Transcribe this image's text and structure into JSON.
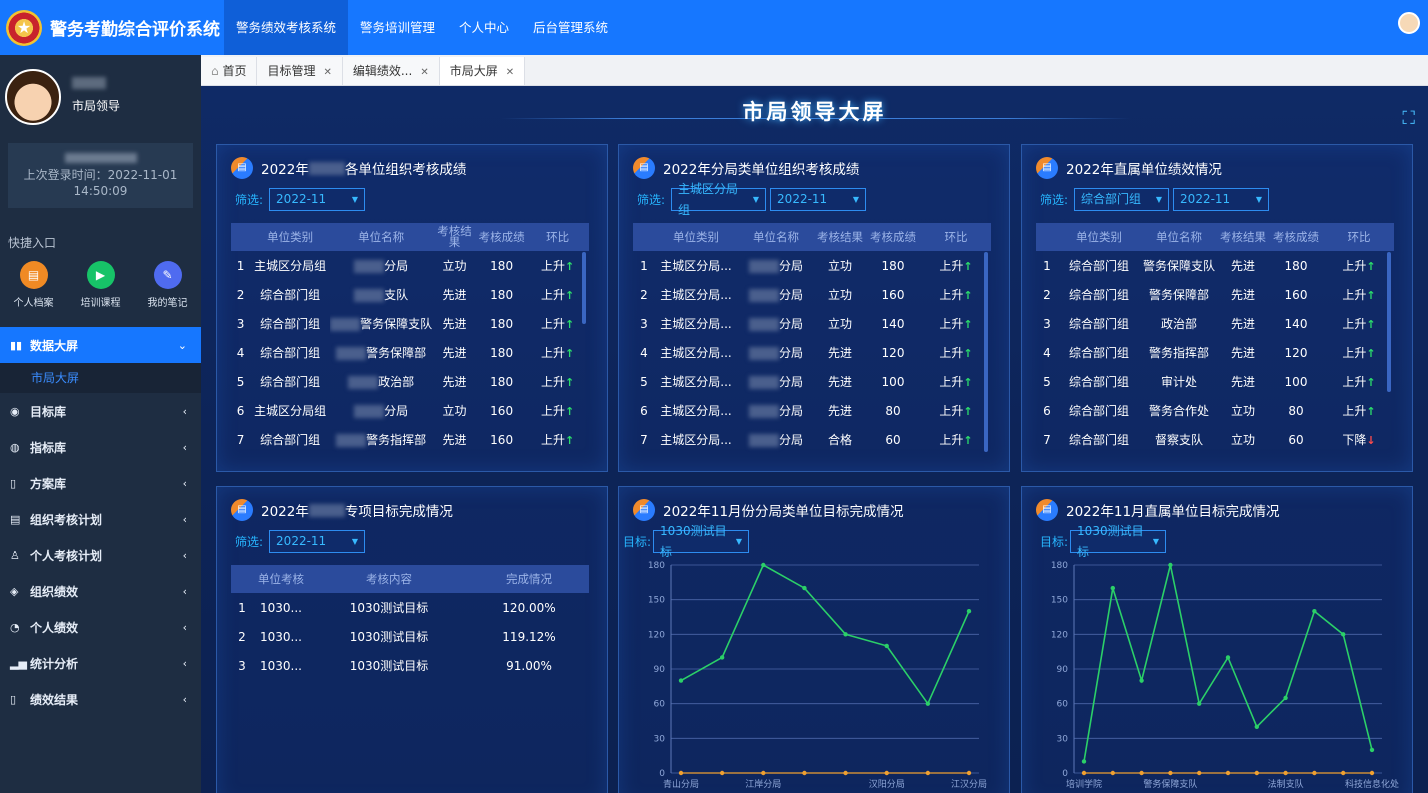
{
  "app": {
    "title": "警务考勤综合评价系统"
  },
  "topnav": [
    "警务绩效考核系统",
    "警务培训管理",
    "个人中心",
    "后台管理系统"
  ],
  "user": {
    "role": "市局领导",
    "login_label": "上次登录时间：2022-11-01",
    "login_time": "14:50:09"
  },
  "quick": {
    "title": "快捷入口",
    "items": [
      {
        "label": "个人档案",
        "color": "#f08a24",
        "icon": "file-icon"
      },
      {
        "label": "培训课程",
        "color": "#17c368",
        "icon": "play-icon"
      },
      {
        "label": "我的笔记",
        "color": "#4f6bf0",
        "icon": "edit-icon"
      }
    ]
  },
  "menu": [
    {
      "label": "数据大屏",
      "icon": "chart-icon",
      "active": true,
      "expanded": true
    },
    {
      "label": "目标库",
      "icon": "target-icon"
    },
    {
      "label": "指标库",
      "icon": "compass-icon"
    },
    {
      "label": "方案库",
      "icon": "book-icon"
    },
    {
      "label": "组织考核计划",
      "icon": "doc-icon"
    },
    {
      "label": "个人考核计划",
      "icon": "person-icon"
    },
    {
      "label": "组织绩效",
      "icon": "layers-icon"
    },
    {
      "label": "个人绩效",
      "icon": "user-icon"
    },
    {
      "label": "统计分析",
      "icon": "stats-icon"
    },
    {
      "label": "绩效结果",
      "icon": "result-icon"
    }
  ],
  "submenu": {
    "label": "市局大屏"
  },
  "tabs": [
    {
      "label": "首页",
      "closable": false
    },
    {
      "label": "目标管理",
      "closable": true
    },
    {
      "label": "编辑绩效...",
      "closable": true
    },
    {
      "label": "市局大屏",
      "closable": true,
      "active": true
    }
  ],
  "screen": {
    "title": "市局领导大屏"
  },
  "panels": {
    "p1": {
      "title_pre": "2022年",
      "title_post": "各单位组织考核成绩",
      "filter_label": "筛选:",
      "date": "2022-11",
      "headers": [
        "单位类别",
        "单位名称",
        "考核结果",
        "考核成绩",
        "环比"
      ],
      "rows": [
        [
          "1",
          "主城区分局组",
          "分局",
          "立功",
          "180",
          "上升"
        ],
        [
          "2",
          "综合部门组",
          "支队",
          "先进",
          "180",
          "上升"
        ],
        [
          "3",
          "综合部门组",
          "警务保障支队",
          "先进",
          "180",
          "上升"
        ],
        [
          "4",
          "综合部门组",
          "警务保障部",
          "先进",
          "180",
          "上升"
        ],
        [
          "5",
          "综合部门组",
          "政治部",
          "先进",
          "180",
          "上升"
        ],
        [
          "6",
          "主城区分局组",
          "分局",
          "立功",
          "160",
          "上升"
        ],
        [
          "7",
          "综合部门组",
          "警务指挥部",
          "先进",
          "160",
          "上升"
        ]
      ]
    },
    "p2": {
      "title": "2022年分局类单位组织考核成绩",
      "filter_label": "筛选:",
      "group": "主城区分局组",
      "date": "2022-11",
      "headers": [
        "单位类别",
        "单位名称",
        "考核结果",
        "考核成绩",
        "环比"
      ],
      "rows": [
        [
          "1",
          "主城区分局...",
          "分局",
          "立功",
          "180",
          "上升"
        ],
        [
          "2",
          "主城区分局...",
          "分局",
          "立功",
          "160",
          "上升"
        ],
        [
          "3",
          "主城区分局...",
          "分局",
          "立功",
          "140",
          "上升"
        ],
        [
          "4",
          "主城区分局...",
          "分局",
          "先进",
          "120",
          "上升"
        ],
        [
          "5",
          "主城区分局...",
          "分局",
          "先进",
          "100",
          "上升"
        ],
        [
          "6",
          "主城区分局...",
          "分局",
          "先进",
          "80",
          "上升"
        ],
        [
          "7",
          "主城区分局...",
          "分局",
          "合格",
          "60",
          "上升"
        ]
      ]
    },
    "p3": {
      "title": "2022年直属单位绩效情况",
      "filter_label": "筛选:",
      "group": "综合部门组",
      "date": "2022-11",
      "headers": [
        "单位类别",
        "单位名称",
        "考核结果",
        "考核成绩",
        "环比"
      ],
      "rows": [
        [
          "1",
          "综合部门组",
          "警务保障支队",
          "先进",
          "180",
          "上升"
        ],
        [
          "2",
          "综合部门组",
          "警务保障部",
          "先进",
          "160",
          "上升"
        ],
        [
          "3",
          "综合部门组",
          "政治部",
          "先进",
          "140",
          "上升"
        ],
        [
          "4",
          "综合部门组",
          "警务指挥部",
          "先进",
          "120",
          "上升"
        ],
        [
          "5",
          "综合部门组",
          "审计处",
          "先进",
          "100",
          "上升"
        ],
        [
          "6",
          "综合部门组",
          "警务合作处",
          "立功",
          "80",
          "上升"
        ],
        [
          "7",
          "综合部门组",
          "督察支队",
          "立功",
          "60",
          "下降"
        ]
      ]
    },
    "p4": {
      "title_pre": "2022年",
      "title_post": "专项目标完成情况",
      "filter_label": "筛选:",
      "date": "2022-11",
      "headers": [
        "单位考核",
        "考核内容",
        "完成情况"
      ],
      "rows": [
        [
          "1",
          "1030...",
          "1030测试目标",
          "120.00%"
        ],
        [
          "2",
          "1030...",
          "1030测试目标",
          "119.12%"
        ],
        [
          "3",
          "1030...",
          "1030测试目标",
          "91.00%"
        ]
      ]
    },
    "p5": {
      "title": "2022年11月份分局类单位目标完成情况",
      "target_label": "目标:",
      "target": "1030测试目标"
    },
    "p6": {
      "title": "2022年11月直属单位目标完成情况",
      "target_label": "目标:",
      "target": "1030测试目标"
    }
  },
  "chart_data": [
    {
      "type": "line",
      "yticks": [
        0,
        30,
        60,
        90,
        120,
        150,
        180
      ],
      "ylim": [
        0,
        180
      ],
      "xlabels_visible": [
        "青山分局",
        "江岸分局",
        "汉阳分局",
        "江汉分局"
      ],
      "series": [
        {
          "values": [
            80,
            100,
            180,
            160,
            120,
            110,
            60,
            140
          ]
        },
        {
          "values": [
            0,
            0,
            0,
            0,
            0,
            0,
            0,
            0
          ]
        }
      ]
    },
    {
      "type": "line",
      "yticks": [
        0,
        30,
        60,
        90,
        120,
        150,
        180
      ],
      "ylim": [
        0,
        180
      ],
      "xlabels_visible": [
        "培训学院",
        "警务保障支队",
        "法制支队",
        "科技信息化处"
      ],
      "series": [
        {
          "values": [
            10,
            160,
            80,
            180,
            60,
            100,
            40,
            65,
            140,
            120,
            20
          ]
        },
        {
          "values": [
            0,
            0,
            0,
            0,
            0,
            0,
            0,
            0,
            0,
            0,
            0
          ]
        }
      ]
    }
  ],
  "colors": {
    "accent": "#1677ff",
    "line_green": "#2bd068",
    "line_orange": "#f0a030",
    "up": "#2bdc6b",
    "down": "#ff4c4c"
  }
}
